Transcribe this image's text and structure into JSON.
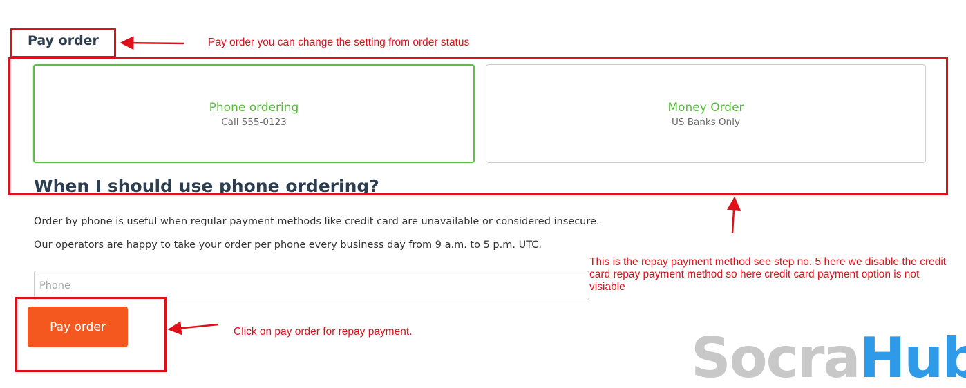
{
  "page": {
    "title": "Pay order"
  },
  "payment_methods": [
    {
      "title": "Phone ordering",
      "subtitle": "Call 555-0123",
      "selected": true
    },
    {
      "title": "Money Order",
      "subtitle": "US Banks Only",
      "selected": false
    }
  ],
  "phone_section": {
    "heading": "When I should use phone ordering?",
    "paragraph_1": "Order by phone is useful when regular payment methods like credit card are unavailable or considered insecure.",
    "paragraph_2": "Our operators are happy to take your order per phone every business day from 9 a.m. to 5 p.m. UTC.",
    "phone_placeholder": "Phone",
    "phone_value": ""
  },
  "actions": {
    "pay_label": "Pay order"
  },
  "annotations": {
    "title_note": "Pay order you can change the setting from order status",
    "methods_note": "This is the repay payment method see step no. 5 here we disable the credit card repay payment method so here credit card payment option is not visiable",
    "button_note": "Click on pay order for repay payment."
  },
  "watermark": {
    "part1": "Socra",
    "part2": "Hub"
  },
  "colors": {
    "accent_green": "#5bc044",
    "button_orange": "#f4581f",
    "annotation_red": "#e0101a",
    "heading_dark": "#2d3e50",
    "watermark_blue": "#2e9ae8",
    "watermark_gray": "#c8c8c8"
  }
}
